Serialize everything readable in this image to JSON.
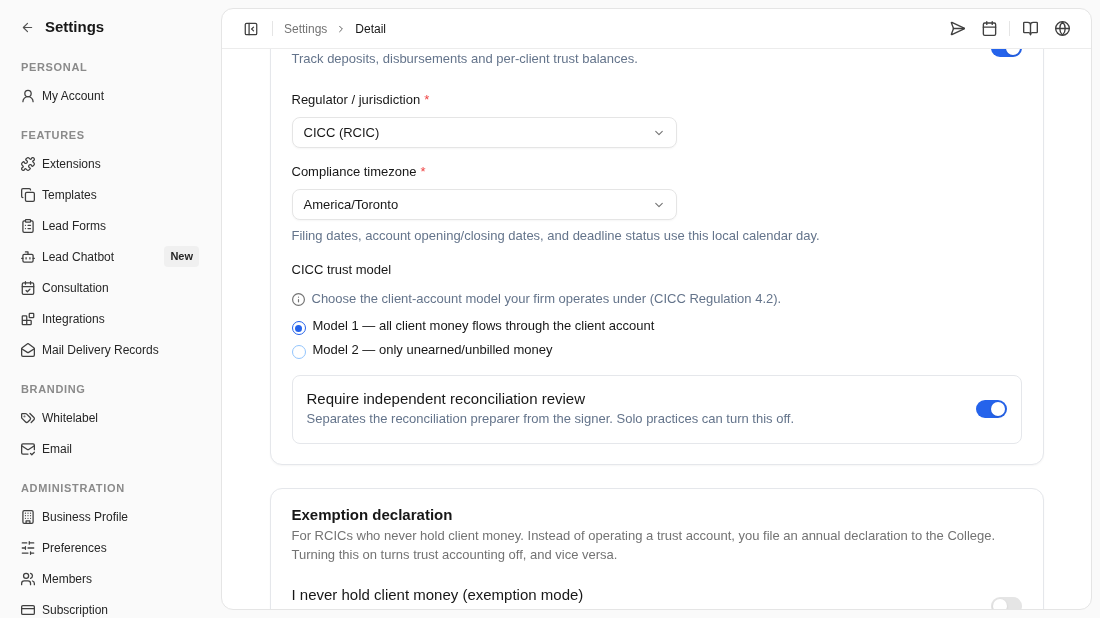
{
  "sidebar": {
    "back_title": "Settings",
    "sections": [
      {
        "heading": "PERSONAL",
        "items": [
          {
            "label": "My Account",
            "selected": false
          }
        ]
      },
      {
        "heading": "FEATURES",
        "items": [
          {
            "label": "Extensions",
            "selected": false
          },
          {
            "label": "Templates",
            "selected": false
          },
          {
            "label": "Lead Forms",
            "selected": false
          },
          {
            "label": "Lead Chatbot",
            "selected": false,
            "badge": "New"
          },
          {
            "label": "Consultation",
            "selected": false
          },
          {
            "label": "Integrations",
            "selected": false
          },
          {
            "label": "Mail Delivery Records",
            "selected": false
          }
        ]
      },
      {
        "heading": "BRANDING",
        "items": [
          {
            "label": "Whitelabel",
            "selected": false
          },
          {
            "label": "Email",
            "selected": false
          }
        ]
      },
      {
        "heading": "ADMINISTRATION",
        "items": [
          {
            "label": "Business Profile",
            "selected": false
          },
          {
            "label": "Preferences",
            "selected": false
          },
          {
            "label": "Members",
            "selected": false
          },
          {
            "label": "Subscription",
            "selected": false
          }
        ]
      }
    ]
  },
  "header": {
    "breadcrumbs": [
      "Settings",
      "Detail"
    ]
  },
  "trust_accounting": {
    "description": "Track deposits, disbursements and per-client trust balances.",
    "on": true,
    "fields": [
      {
        "label": "Regulator / jurisdiction",
        "required_mark": "*",
        "value": "CICC (RCIC)"
      },
      {
        "label": "Compliance timezone",
        "required_mark": "*",
        "value": "America/Toronto",
        "help": "Filing dates, account opening/closing dates, and deadline status use this local calendar day."
      }
    ],
    "trust_model": {
      "label": "CICC trust model",
      "hint": "Choose the client-account model your firm operates under (CICC Regulation 4.2).",
      "options": [
        {
          "label": "Model 1 — all client money flows through the client account",
          "selected": true
        },
        {
          "label": "Model 2 — only unearned/unbilled money",
          "selected": false
        }
      ]
    },
    "review": {
      "title": "Require independent reconciliation review",
      "description": "Separates the reconciliation preparer from the signer. Solo practices can turn this off.",
      "on": true
    }
  },
  "exemption": {
    "title": "Exemption declaration",
    "description": "For RCICs who never hold client money. Instead of operating a trust account, you file an annual declaration to the College. Turning this on turns trust accounting off, and vice versa.",
    "setting": {
      "label": "I never hold client money (exemption mode)",
      "on": false
    }
  }
}
